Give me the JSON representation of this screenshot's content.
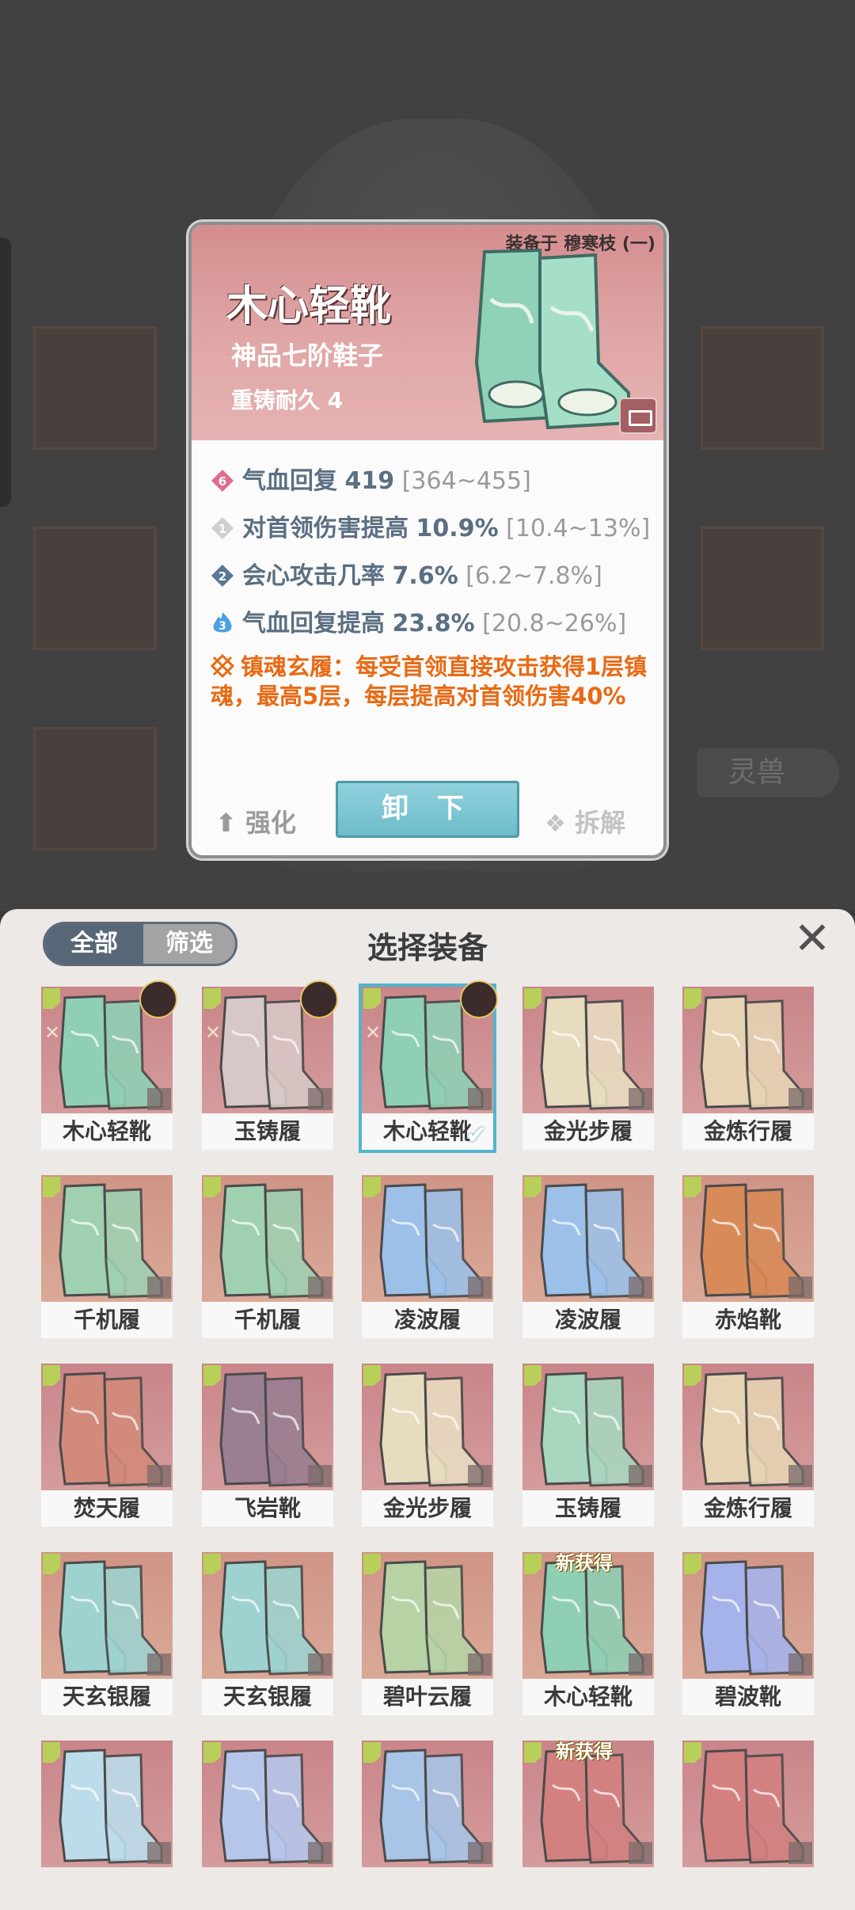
{
  "background": {
    "tag_label": "灵兽"
  },
  "detail": {
    "equipped_to": "装备于 穆寒枝 (一)",
    "name": "木心轻靴",
    "grade": "神品七阶鞋子",
    "reforge": "重铸耐久 4",
    "stats": [
      {
        "badge": "6",
        "name": "气血回复",
        "value": "419",
        "range": "[364~455]",
        "color": "#e06c8e"
      },
      {
        "badge": "1",
        "name": "对首领伤害提高",
        "value": "10.9%",
        "range": "[10.4~13%]",
        "color": "#cfcfcf"
      },
      {
        "badge": "2",
        "name": "会心攻击几率",
        "value": "7.6%",
        "range": "[6.2~7.8%]",
        "color": "#5a7896"
      },
      {
        "badge": "3",
        "name": "气血回复提高",
        "value": "23.8%",
        "range": "[20.8~26%]",
        "color": "#4aa0e0"
      }
    ],
    "special": "镇魂玄履：每受首领直接攻击获得1层镇魂，最高5层，每层提高对首领伤害40%",
    "btn_upgrade": "强化",
    "btn_unequip": "卸 下",
    "btn_dismantle": "拆解"
  },
  "panel": {
    "tab_all": "全部",
    "tab_filter": "筛选",
    "title": "选择装备",
    "close_icon": "✕"
  },
  "items": [
    {
      "name": "木心轻靴",
      "color": "#8fcfb4",
      "avatar": true,
      "rune": true
    },
    {
      "name": "玉铸履",
      "color": "#d8c7c7",
      "avatar": true,
      "rune": true
    },
    {
      "name": "木心轻靴",
      "color": "#8fcfb4",
      "avatar": true,
      "rune": true,
      "selected": true
    },
    {
      "name": "金光步履",
      "color": "#e8dcc0"
    },
    {
      "name": "金炼行履",
      "color": "#e6d3b4"
    },
    {
      "name": "千机履",
      "color": "#9fd0b0"
    },
    {
      "name": "千机履",
      "color": "#9fd0b0"
    },
    {
      "name": "凌波履",
      "color": "#9cc0e8"
    },
    {
      "name": "凌波履",
      "color": "#9cc0e8"
    },
    {
      "name": "赤焰靴",
      "color": "#d88a58"
    },
    {
      "name": "焚天履",
      "color": "#d28a7a"
    },
    {
      "name": "飞岩靴",
      "color": "#9a7f92"
    },
    {
      "name": "金光步履",
      "color": "#e8dcc0"
    },
    {
      "name": "玉铸履",
      "color": "#a8d6bf"
    },
    {
      "name": "金炼行履",
      "color": "#e6d3b4"
    },
    {
      "name": "天玄银履",
      "color": "#9ed2d0"
    },
    {
      "name": "天玄银履",
      "color": "#9ed2d0"
    },
    {
      "name": "碧叶云履",
      "color": "#b7d3a6"
    },
    {
      "name": "木心轻靴",
      "color": "#8fcfb4",
      "new": "新获得"
    },
    {
      "name": "碧波靴",
      "color": "#a6b3ea"
    },
    {
      "name": "",
      "color": "#bcdcec"
    },
    {
      "name": "",
      "color": "#b6c6ea"
    },
    {
      "name": "",
      "color": "#a8c4e6"
    },
    {
      "name": "",
      "color": "#d38080",
      "new": "新获得"
    },
    {
      "name": "",
      "color": "#d38080"
    }
  ]
}
